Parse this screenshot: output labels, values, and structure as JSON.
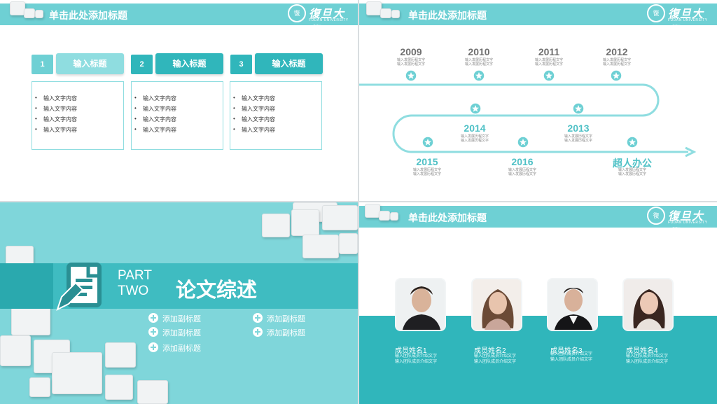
{
  "header_title": "单击此处添加标题",
  "logo": {
    "cn": "復旦大學",
    "en": "FUDAN UNIVERSITY"
  },
  "slide1": {
    "columns": [
      {
        "num": "1",
        "title": "输入标题",
        "items": [
          "输入文字内容",
          "输入文字内容",
          "输入文字内容",
          "输入文字内容"
        ]
      },
      {
        "num": "2",
        "title": "输入标题",
        "items": [
          "输入文字内容",
          "输入文字内容",
          "输入文字内容",
          "输入文字内容"
        ]
      },
      {
        "num": "3",
        "title": "输入标题",
        "items": [
          "输入文字内容",
          "输入文字内容",
          "输入文字内容",
          "输入文字内容"
        ]
      }
    ]
  },
  "slide2": {
    "milestones": [
      {
        "label": "2009",
        "sub1": "输入发展历程文字",
        "sub2": "输入发展历程文字"
      },
      {
        "label": "2010",
        "sub1": "输入发展历程文字",
        "sub2": "输入发展历程文字"
      },
      {
        "label": "2011",
        "sub1": "输入发展历程文字",
        "sub2": "输入发展历程文字"
      },
      {
        "label": "2012",
        "sub1": "输入发展历程文字",
        "sub2": "输入发展历程文字"
      },
      {
        "label": "2014",
        "sub1": "输入发展历程文字",
        "sub2": "输入发展历程文字"
      },
      {
        "label": "2013",
        "sub1": "输入发展历程文字",
        "sub2": "输入发展历程文字"
      },
      {
        "label": "2015",
        "sub1": "输入发展历程文字",
        "sub2": "输入发展历程文字"
      },
      {
        "label": "2016",
        "sub1": "输入发展历程文字",
        "sub2": "输入发展历程文字"
      },
      {
        "label": "超人办公",
        "sub1": "输入发展历程文字",
        "sub2": "输入发展历程文字"
      }
    ]
  },
  "slide3": {
    "part": "PART",
    "part_num": "TWO",
    "title": "论文综述",
    "subtitles": [
      "添加副标题",
      "添加副标题",
      "添加副标题",
      "添加副标题",
      "添加副标题"
    ]
  },
  "slide4": {
    "members": [
      {
        "name": "成员姓名1",
        "desc1": "输入团队成员介绍文字",
        "desc2": "输入团队成员介绍文字"
      },
      {
        "name": "成员姓名2",
        "desc1": "输入团队成员介绍文字",
        "desc2": "输入团队成员介绍文字"
      },
      {
        "name": "成员姓名3",
        "desc1": "输入团队成员介绍文字",
        "desc2": "输入团队成员介绍文字"
      },
      {
        "name": "成员姓名4",
        "desc1": "输入团队成员介绍文字",
        "desc2": "输入团队成员介绍文字"
      }
    ]
  },
  "colors": {
    "teal_light": "#6ed0d4",
    "teal_dark": "#30b6bb",
    "teal_bg": "#7fd6da"
  }
}
